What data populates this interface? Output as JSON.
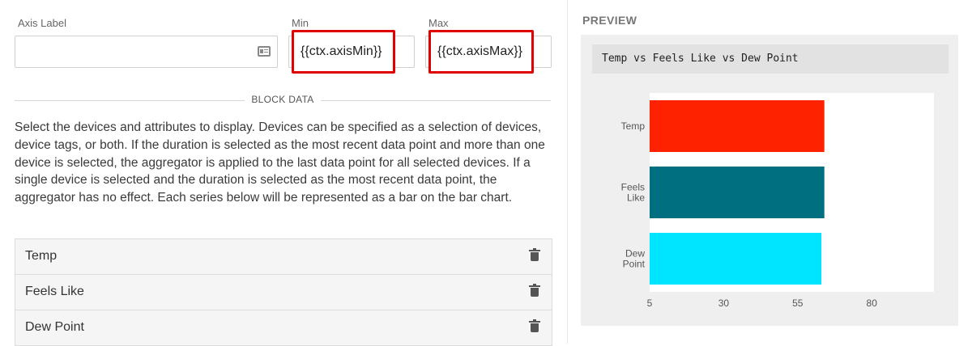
{
  "form": {
    "axis_label": {
      "label": "Axis Label",
      "value": ""
    },
    "min": {
      "label": "Min",
      "value": "{{ctx.axisMin}}"
    },
    "max": {
      "label": "Max",
      "value": "{{ctx.axisMax}}"
    }
  },
  "section": {
    "title": "BLOCK DATA"
  },
  "description": "Select the devices and attributes to display. Devices can be specified as a selection of devices, device tags, or both. If the duration is selected as the most recent data point and more than one device is selected, the aggregator is applied to the last data point for all selected devices. If a single device is selected and the duration is selected as the most recent data point, the aggregator has no effect. Each series below will be represented as a bar on the bar chart.",
  "series_list": [
    {
      "label": "Temp"
    },
    {
      "label": "Feels Like"
    },
    {
      "label": "Dew Point"
    }
  ],
  "preview": {
    "title": "PREVIEW"
  },
  "chart_data": {
    "type": "bar",
    "orientation": "horizontal",
    "title": "Temp vs Feels Like vs Dew Point",
    "categories": [
      [
        "Temp"
      ],
      [
        "Feels",
        "Like"
      ],
      [
        "Dew",
        "Point"
      ]
    ],
    "values": [
      64,
      64,
      63
    ],
    "colors": [
      "#ff2200",
      "#007080",
      "#00e5ff"
    ],
    "xticks": [
      5,
      30,
      55,
      80
    ],
    "xlim": [
      5,
      101
    ],
    "grid": false,
    "legend": "none"
  }
}
